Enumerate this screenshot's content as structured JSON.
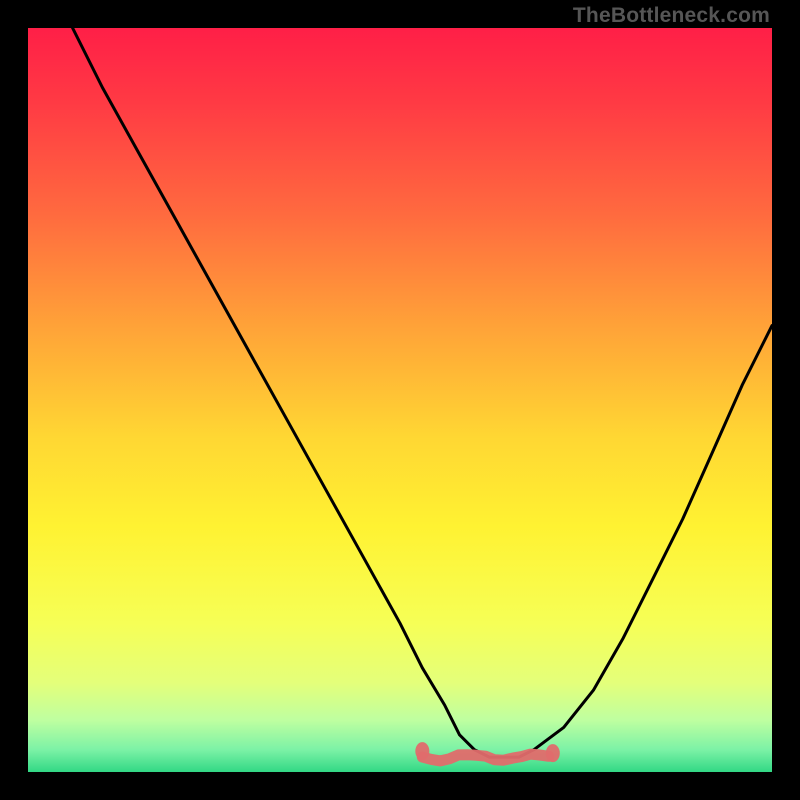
{
  "watermark": "TheBottleneck.com",
  "chart_data": {
    "type": "line",
    "title": "",
    "xlabel": "",
    "ylabel": "",
    "xlim": [
      0,
      100
    ],
    "ylim": [
      0,
      100
    ],
    "background_gradient_stops": [
      {
        "offset": 0.0,
        "color": "#ff1f47"
      },
      {
        "offset": 0.1,
        "color": "#ff3a44"
      },
      {
        "offset": 0.25,
        "color": "#ff6a3f"
      },
      {
        "offset": 0.4,
        "color": "#ffa238"
      },
      {
        "offset": 0.55,
        "color": "#ffd733"
      },
      {
        "offset": 0.67,
        "color": "#fff232"
      },
      {
        "offset": 0.8,
        "color": "#f6ff56"
      },
      {
        "offset": 0.88,
        "color": "#e4ff7a"
      },
      {
        "offset": 0.93,
        "color": "#bfffa0"
      },
      {
        "offset": 0.97,
        "color": "#7cf2a6"
      },
      {
        "offset": 1.0,
        "color": "#32d885"
      }
    ],
    "series": [
      {
        "name": "bottleneck-curve",
        "color": "#000000",
        "x": [
          6,
          10,
          15,
          20,
          25,
          30,
          35,
          40,
          45,
          50,
          53,
          56,
          58,
          60,
          62,
          64,
          66,
          68,
          72,
          76,
          80,
          84,
          88,
          92,
          96,
          100
        ],
        "y": [
          100,
          92,
          83,
          74,
          65,
          56,
          47,
          38,
          29,
          20,
          14,
          9,
          5,
          3,
          2,
          2,
          2,
          3,
          6,
          11,
          18,
          26,
          34,
          43,
          52,
          60
        ]
      }
    ],
    "annotation_band": {
      "name": "optimal-range",
      "color": "#e06b6b",
      "x_range": [
        53,
        70
      ],
      "y": 2
    }
  }
}
